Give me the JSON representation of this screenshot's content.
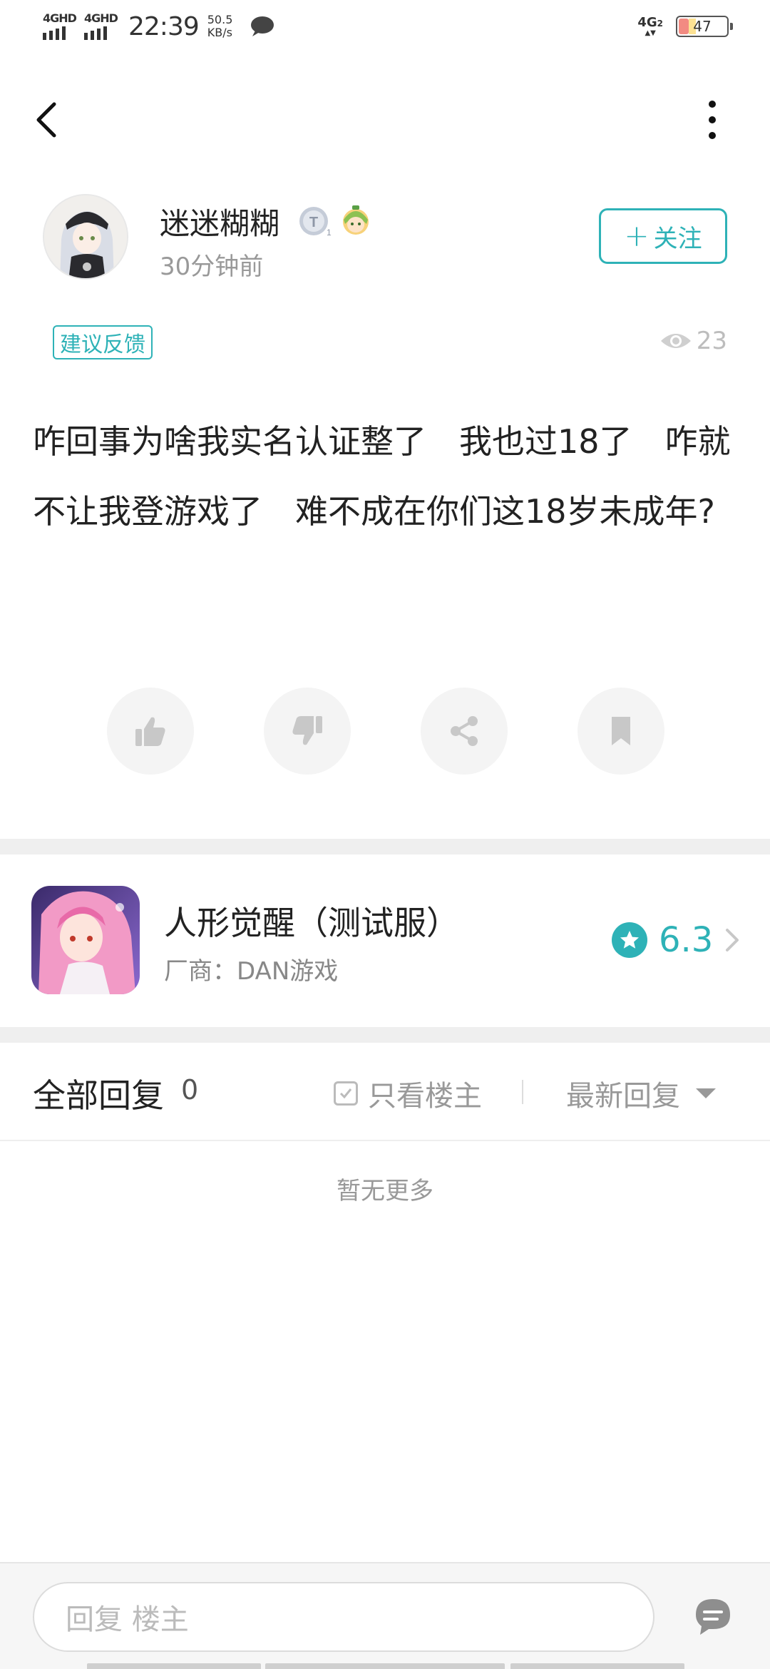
{
  "status_bar": {
    "sim1": "4GHD",
    "sim2": "4GHD",
    "time": "22:39",
    "speed_value": "50.5",
    "speed_unit": "KB/s",
    "network": "4G",
    "network_sub": "2",
    "battery": "47"
  },
  "author": {
    "name": "迷迷糊糊",
    "time_ago": "30分钟前",
    "follow_label": "关注"
  },
  "post": {
    "tag": "建议反馈",
    "views": "23",
    "content": "咋回事为啥我实名认证整了　我也过18了　咋就不让我登游戏了　难不成在你们这18岁未成年?"
  },
  "game": {
    "name": "人形觉醒（测试服）",
    "vendor": "厂商：DAN游戏",
    "rating": "6.3"
  },
  "replies": {
    "title": "全部回复",
    "count": "0",
    "only_owner_label": "只看楼主",
    "sort_label": "最新回复",
    "empty_text": "暂无更多"
  },
  "reply_bar": {
    "placeholder": "回复  楼主"
  },
  "colors": {
    "accent": "#2eb2b7",
    "muted": "#999999",
    "divider": "#efefef"
  },
  "icons": {
    "back": "chevron-left-icon",
    "more": "more-vertical-icon",
    "views": "eye-icon",
    "like": "thumbs-up-icon",
    "dislike": "thumbs-down-icon",
    "share": "share-icon",
    "bookmark": "bookmark-icon",
    "rating": "star-icon",
    "reply": "comment-icon"
  }
}
